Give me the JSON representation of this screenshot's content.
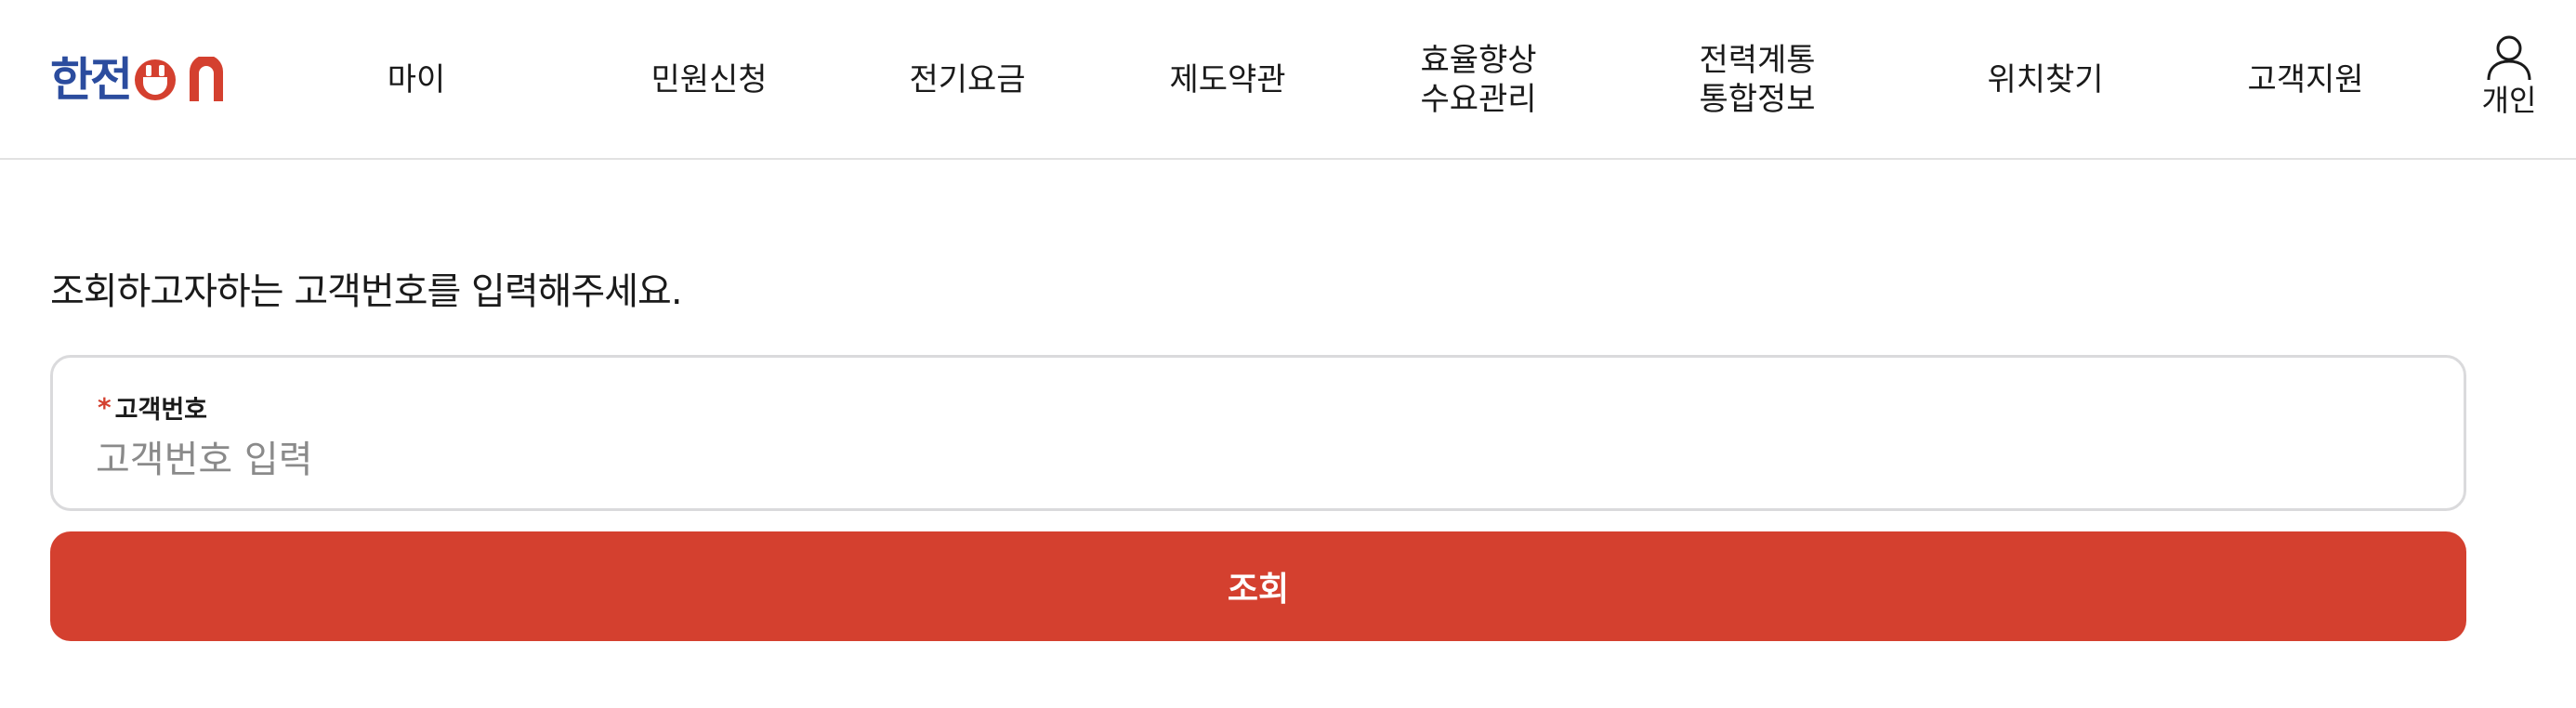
{
  "brand": {
    "name_text": "한전",
    "logo_suffix_icon": "on-plug-logo",
    "primary_color": "#2b4c9e",
    "accent_color": "#d4402f"
  },
  "nav": {
    "items": [
      {
        "label": "마이"
      },
      {
        "label": "민원신청"
      },
      {
        "label": "전기요금"
      },
      {
        "label": "제도약관"
      },
      {
        "label": "효율향상\n수요관리"
      },
      {
        "label": "전력계통\n통합정보"
      },
      {
        "label": "위치찾기"
      },
      {
        "label": "고객지원"
      }
    ],
    "user": {
      "label": "개인",
      "icon": "user-icon"
    }
  },
  "main": {
    "prompt": "조회하고자하는 고객번호를 입력해주세요.",
    "field": {
      "required_mark": "*",
      "label": "고객번호",
      "placeholder": "고객번호 입력",
      "value": ""
    },
    "submit_label": "조회"
  }
}
